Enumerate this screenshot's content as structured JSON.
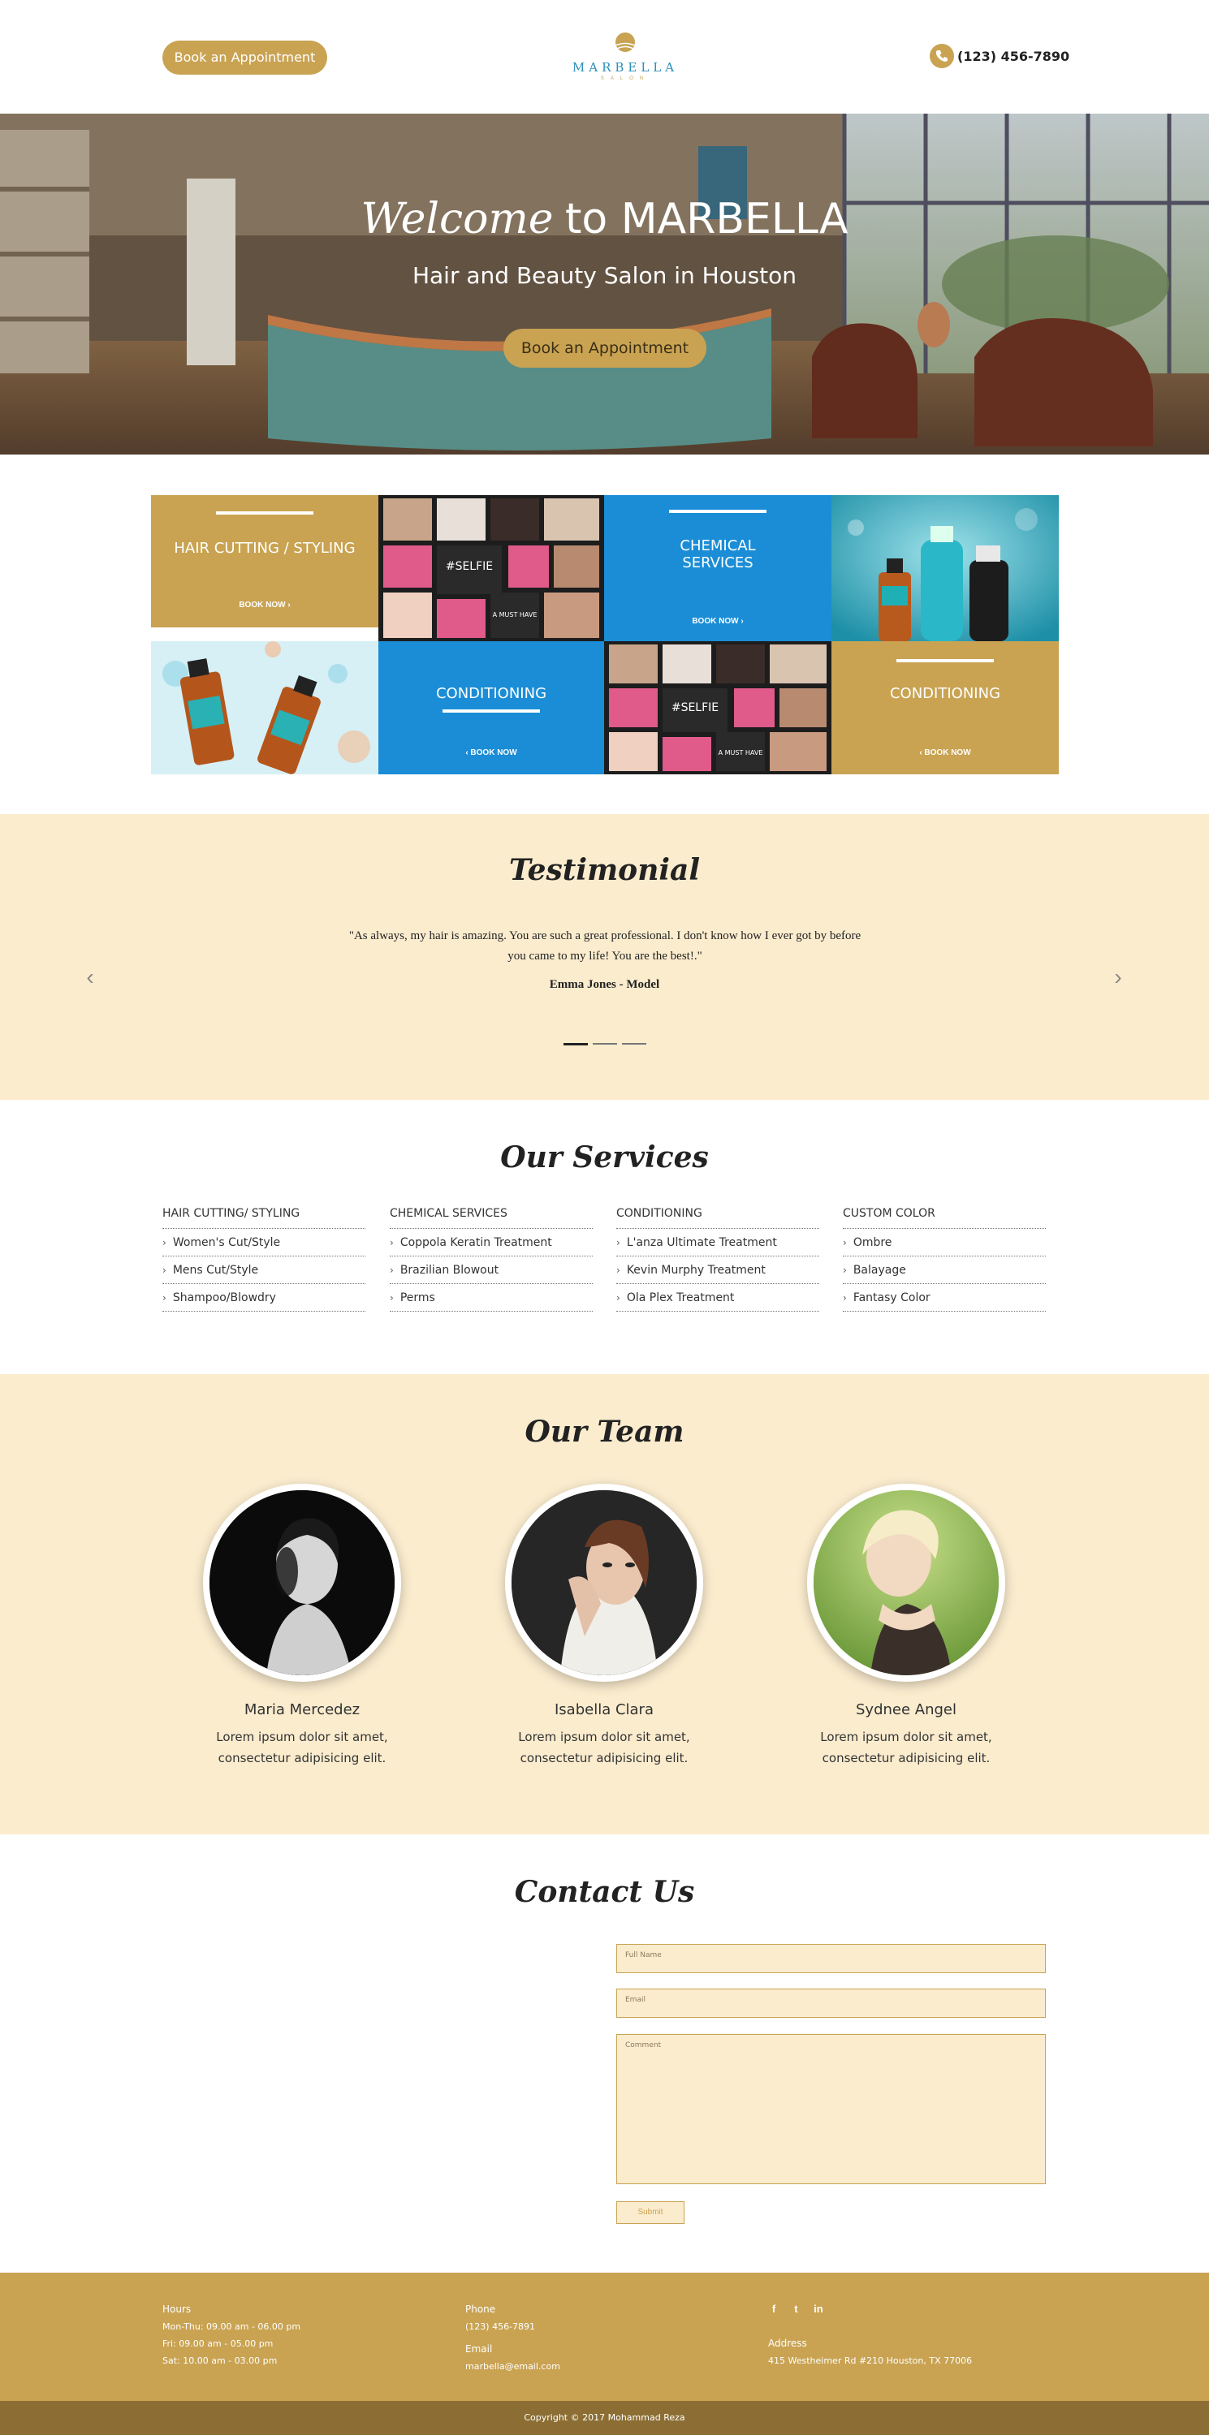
{
  "header": {
    "appointment_button": "Book an Appointment",
    "logo_text": "MARBELLA",
    "logo_subtext": "SALON",
    "phone": "(123) 456-7890"
  },
  "hero": {
    "title_script": "Welcome",
    "title_plain": "to MARBELLA",
    "subtitle": "Hair and Beauty Salon in Houston",
    "button": "Book an Appointment"
  },
  "tiles": {
    "hair_cutting": {
      "title": "HAIR CUTTING / STYLING",
      "link": "BOOK NOW ›"
    },
    "chemical": {
      "title_line1": "CHEMICAL",
      "title_line2": "SERVICES",
      "link": "BOOK NOW ›"
    },
    "conditioning_a": {
      "title": "CONDITIONING",
      "link": "‹ BOOK NOW"
    },
    "conditioning_b": {
      "title": "CONDITIONING",
      "link": "‹ BOOK NOW"
    }
  },
  "testimonial": {
    "title": "Testimonial",
    "quote": "\"As always, my hair is amazing. You are such a great professional. I don't know how I ever got by before you came to my life! You are the best!.\"",
    "author": "Emma Jones - Model",
    "prev_icon": "chevron-left-icon",
    "next_icon": "chevron-right-icon"
  },
  "services": {
    "title": "Our Services",
    "columns": [
      {
        "heading": "HAIR CUTTING/ STYLING",
        "items": [
          "Women's Cut/Style",
          "Mens Cut/Style",
          "Shampoo/Blowdry"
        ]
      },
      {
        "heading": "CHEMICAL SERVICES",
        "items": [
          "Coppola Keratin Treatment",
          "Brazilian Blowout",
          "Perms"
        ]
      },
      {
        "heading": "CONDITIONING",
        "items": [
          "L'anza Ultimate Treatment",
          "Kevin Murphy Treatment",
          "Ola Plex Treatment"
        ]
      },
      {
        "heading": "CUSTOM COLOR",
        "items": [
          "Ombre",
          "Balayage",
          "Fantasy Color"
        ]
      }
    ]
  },
  "team": {
    "title": "Our Team",
    "members": [
      {
        "name": "Maria Mercedez",
        "bio": "Lorem ipsum dolor sit amet, consectetur adipisicing elit."
      },
      {
        "name": "Isabella Clara",
        "bio": "Lorem ipsum dolor sit amet, consectetur adipisicing elit."
      },
      {
        "name": "Sydnee Angel",
        "bio": "Lorem ipsum dolor sit amet, consectetur adipisicing elit."
      }
    ]
  },
  "contact": {
    "title": "Contact Us",
    "full_name_placeholder": "Full Name",
    "email_placeholder": "Email",
    "comment_placeholder": "Comment",
    "submit": "Submit"
  },
  "footer": {
    "hours_label": "Hours",
    "hours": [
      "Mon-Thu: 09.00 am - 06.00 pm",
      "Fri: 09.00 am - 05.00 pm",
      "Sat: 10.00 am - 03.00 pm"
    ],
    "phone_label": "Phone",
    "phone": "(123) 456-7891",
    "email_label": "Email",
    "email": "marbella@email.com",
    "social": {
      "facebook": "f",
      "twitter": "t",
      "linkedin": "in"
    },
    "address_label": "Address",
    "address": "415 Westheimer Rd #210 Houston, TX 77006",
    "copyright": "Copyright © 2017 Mohammad Reza"
  },
  "colors": {
    "gold": "#c9a352",
    "blue": "#1a8dd6",
    "cream": "#fbecce",
    "dark_gold": "#8c6e34"
  }
}
